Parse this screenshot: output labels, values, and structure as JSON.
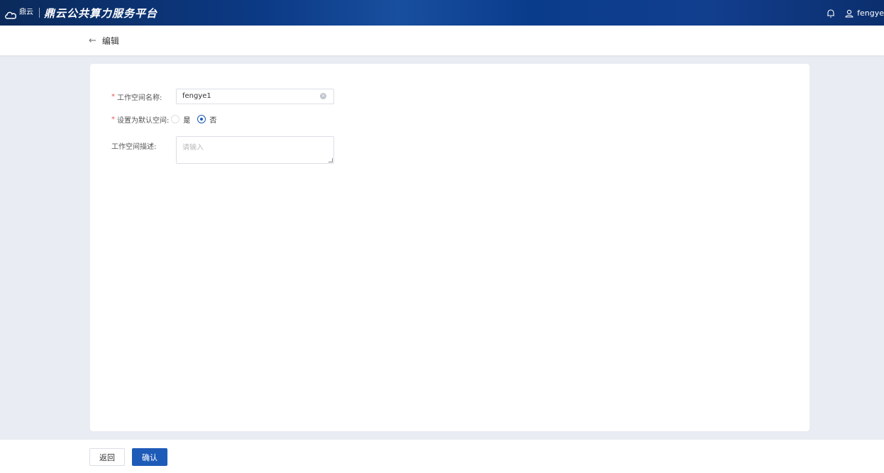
{
  "topbar": {
    "logo_text": "鼎云",
    "title": "鼎云公共算力服务平台",
    "user_name": "fengye"
  },
  "header": {
    "title": "编辑"
  },
  "form": {
    "name_label": "工作空间名称:",
    "name_value": "fengye1",
    "default_label": "设置为默认空间:",
    "default_options": [
      "是",
      "否"
    ],
    "default_selected": "否",
    "desc_label": "工作空间描述:",
    "desc_placeholder": "请输入"
  },
  "footer": {
    "back_label": "返回",
    "confirm_label": "确认"
  },
  "colors": {
    "primary": "#1e5bb8",
    "required": "#e55555"
  }
}
